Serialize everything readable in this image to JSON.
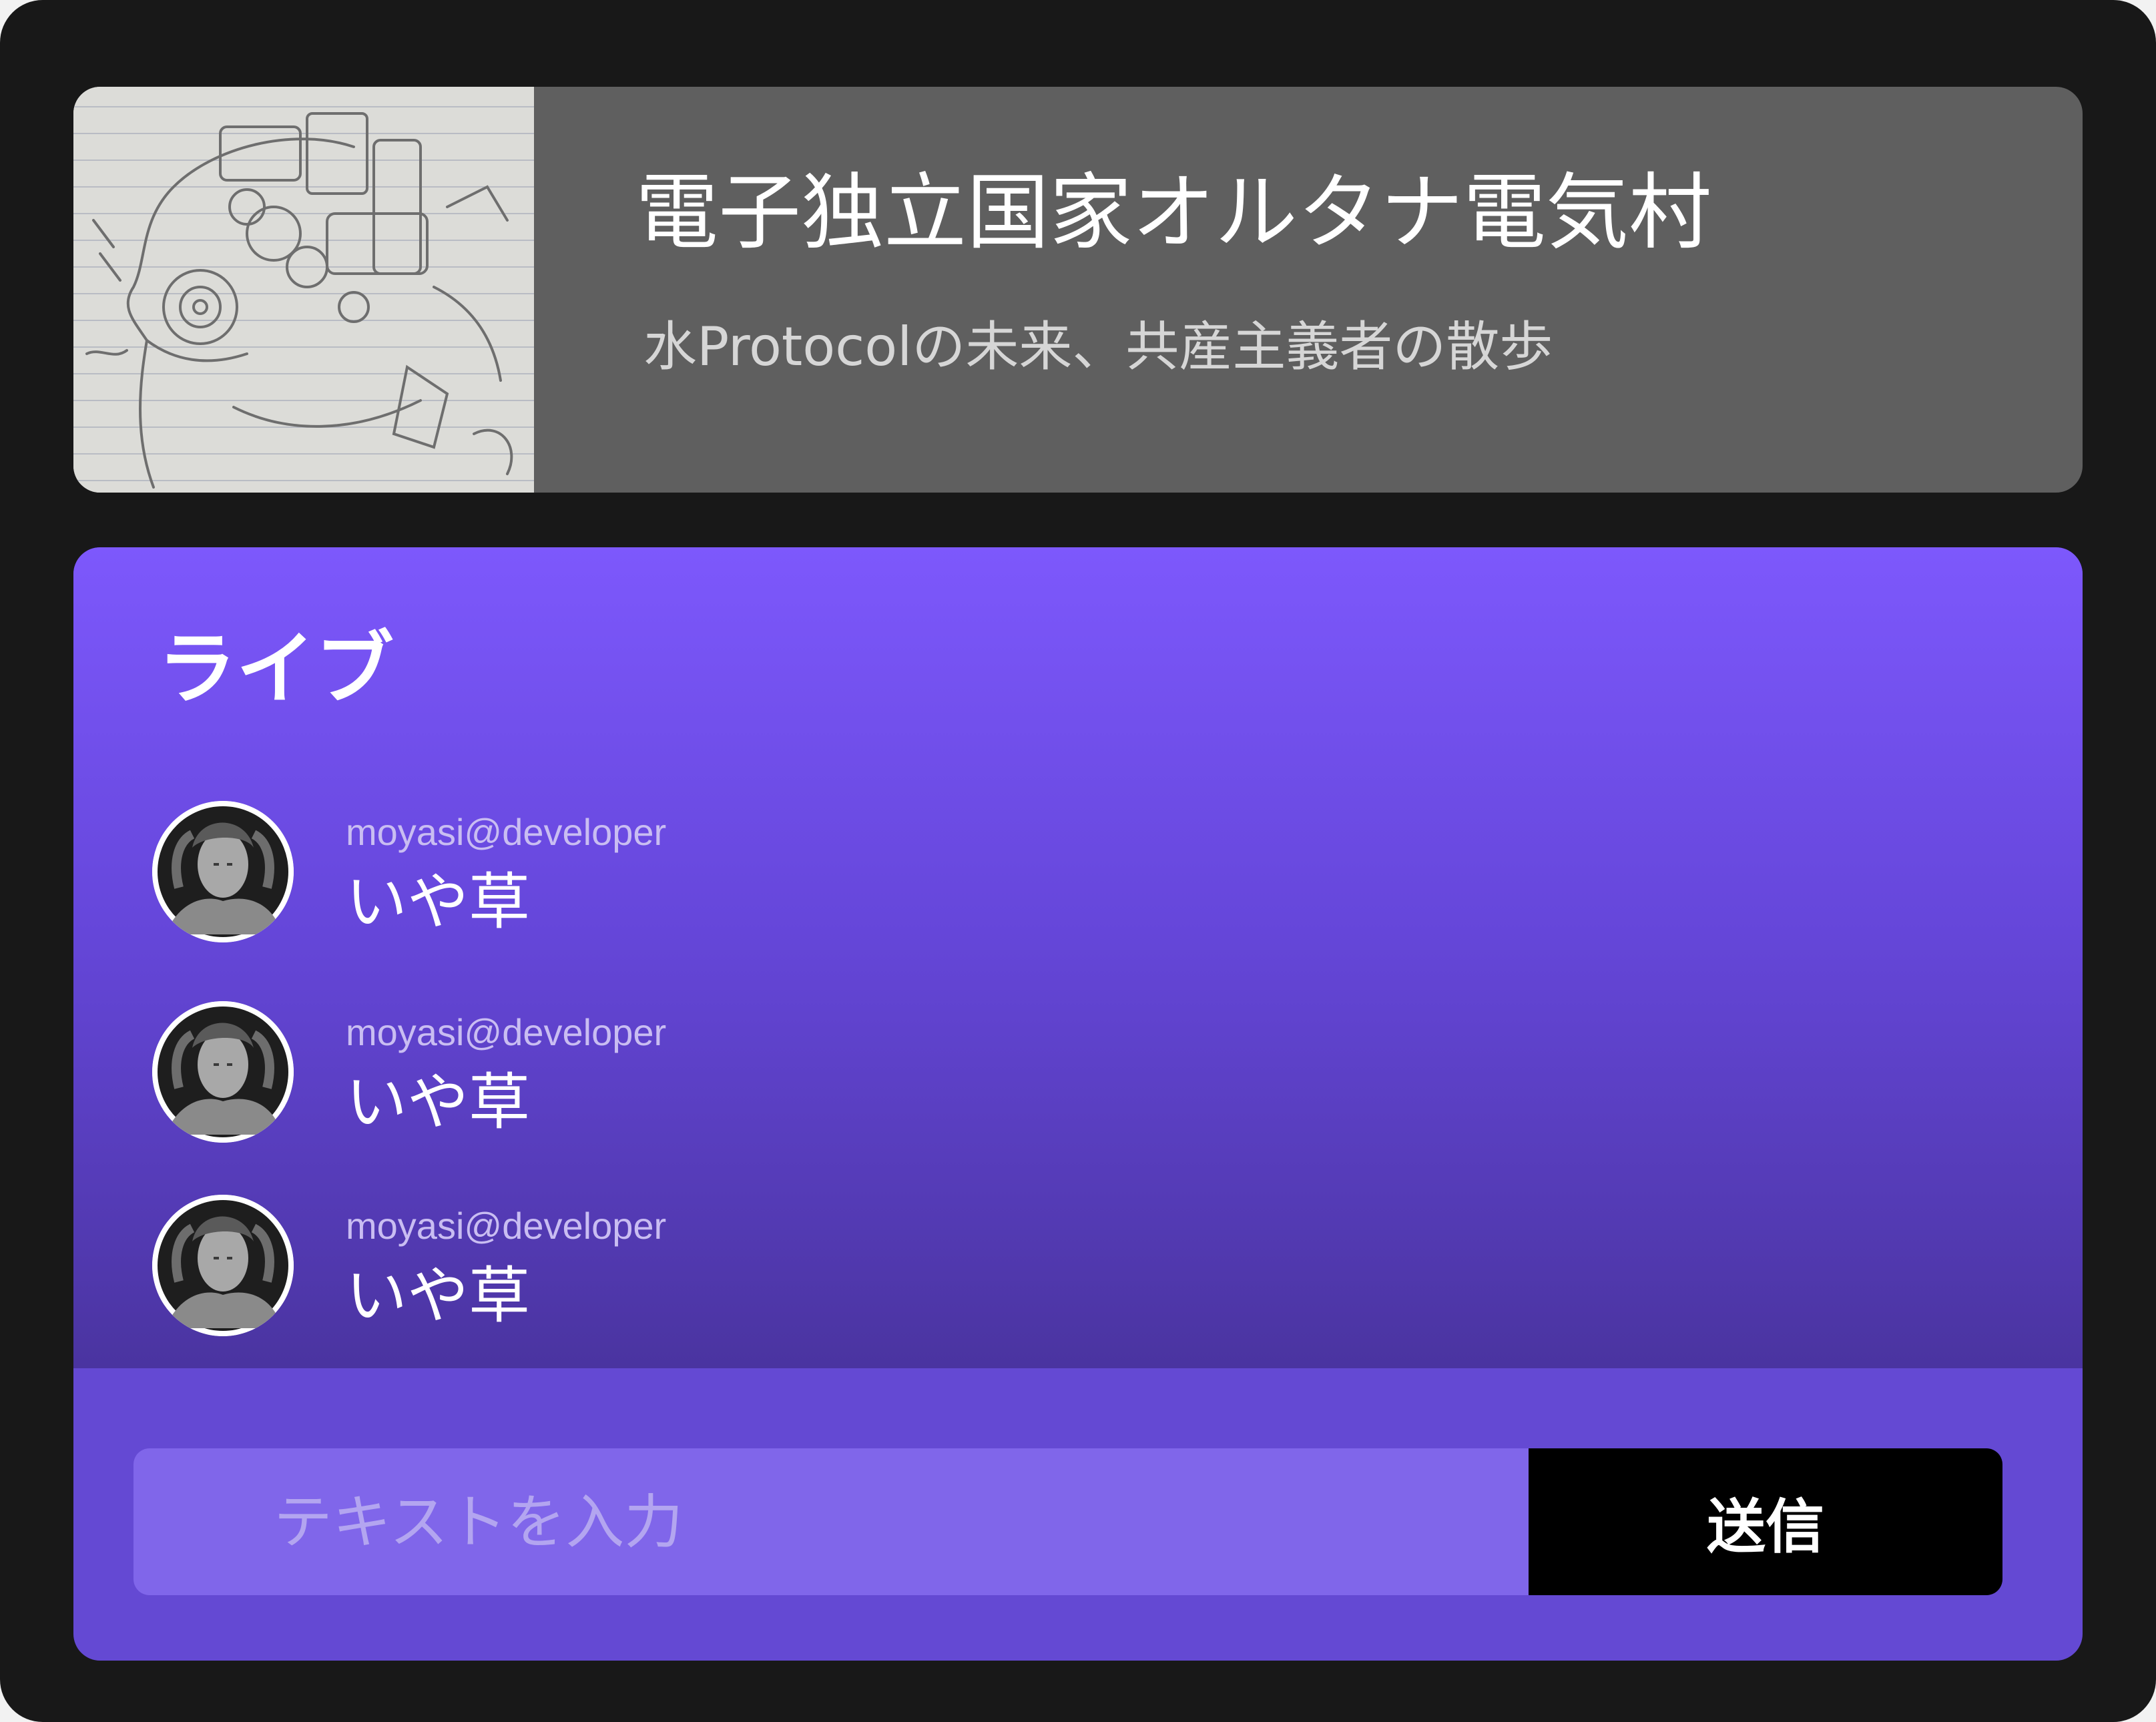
{
  "header": {
    "title": "電子独立国家オルタナ電気村",
    "subtitle": "水Protocolの未来、共産主義者の散歩",
    "thumbnail": "pencil-sketch-robot-head"
  },
  "live": {
    "title": "ライブ",
    "messages": [
      {
        "user": "moyasi@developer",
        "text": "いや草",
        "avatar": "statue-avatar"
      },
      {
        "user": "moyasi@developer",
        "text": "いや草",
        "avatar": "statue-avatar"
      },
      {
        "user": "moyasi@developer",
        "text": "いや草",
        "avatar": "statue-avatar"
      }
    ]
  },
  "composer": {
    "placeholder": "テキストを入力",
    "value": "",
    "send_label": "送信"
  },
  "colors": {
    "background": "#181818",
    "header_card": "#5f5f5f",
    "live_gradient_top": "#7d58fc",
    "live_gradient_bottom": "#4a34a0",
    "composer_area": "#6449d3",
    "input_background": "#8066ea",
    "send_button": "#000000"
  }
}
